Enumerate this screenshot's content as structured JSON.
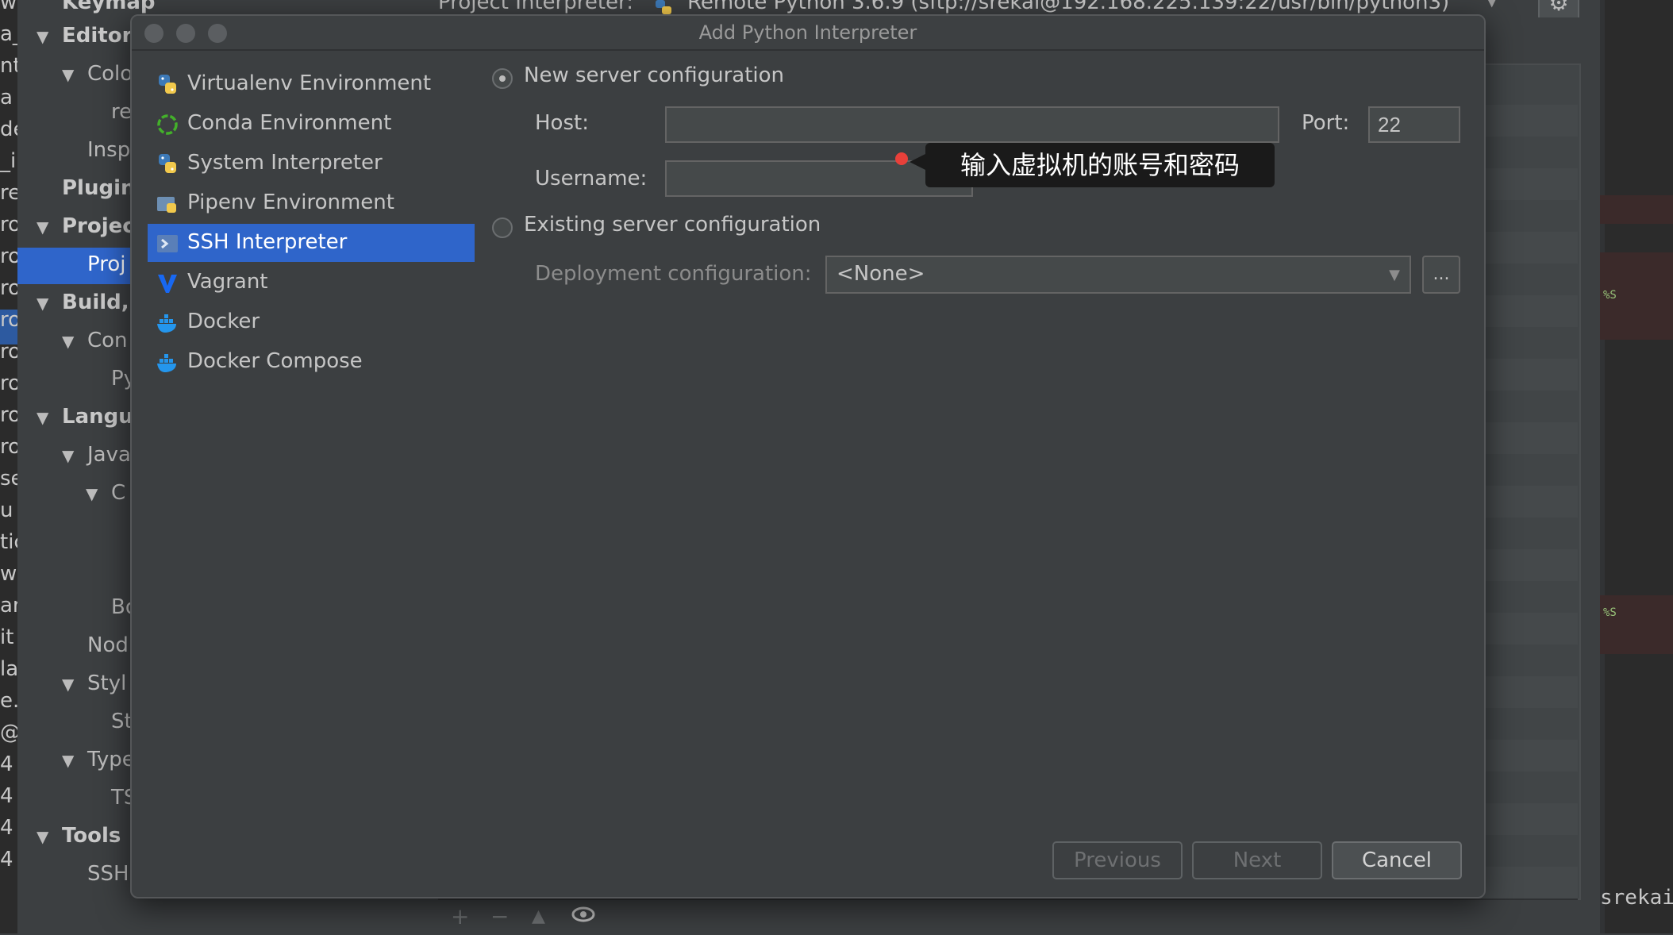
{
  "background": {
    "left_strip_chars": [
      "w",
      "a_",
      "nti",
      "a",
      "de",
      "_i",
      "re",
      "ro",
      "ro",
      "ro",
      "ro",
      "ro",
      "ro",
      "ro",
      "ro",
      "se",
      "u",
      "tic",
      "ws",
      "ar",
      "it",
      "la",
      "e.",
      "@",
      "4",
      "4",
      "4",
      "4"
    ],
    "settings_tree": {
      "nodes": [
        {
          "label": "Keymap",
          "bold": true
        },
        {
          "label": "Editor",
          "bold": true
        },
        {
          "label": "Colo"
        },
        {
          "label": "re"
        },
        {
          "label": "Insp"
        },
        {
          "label": "Plugin",
          "bold": true
        },
        {
          "label": "Projec",
          "bold": true
        },
        {
          "label": "Proj",
          "selected": true
        },
        {
          "label": "Build,",
          "bold": true
        },
        {
          "label": "Con"
        },
        {
          "label": "Py"
        },
        {
          "label": "Langu",
          "bold": true
        },
        {
          "label": "Java"
        },
        {
          "label": "C"
        },
        {
          "label": "Bo"
        },
        {
          "label": "Nod"
        },
        {
          "label": "Styl"
        },
        {
          "label": "St"
        },
        {
          "label": "Type"
        },
        {
          "label": "TS"
        },
        {
          "label": "Tools",
          "bold": true
        },
        {
          "label": "SSH"
        }
      ]
    },
    "project_interpreter": {
      "label": "Project Interpreter:",
      "value": "Remote Python 3.6.9 (sftp://srekai@192.168.225.139:22/usr/bin/python3)"
    },
    "editor": {
      "marker_text": "%S",
      "tail_text": "srekai/D"
    }
  },
  "dialog": {
    "title": "Add Python Interpreter",
    "interpreter_types": [
      {
        "label": "Virtualenv Environment",
        "icon": "python-icon"
      },
      {
        "label": "Conda Environment",
        "icon": "conda-icon"
      },
      {
        "label": "System Interpreter",
        "icon": "python-icon"
      },
      {
        "label": "Pipenv Environment",
        "icon": "pipenv-icon"
      },
      {
        "label": "SSH Interpreter",
        "icon": "ssh-icon",
        "selected": true
      },
      {
        "label": "Vagrant",
        "icon": "vagrant-icon"
      },
      {
        "label": "Docker",
        "icon": "docker-icon"
      },
      {
        "label": "Docker Compose",
        "icon": "docker-icon"
      }
    ],
    "new_server": {
      "label": "New server configuration",
      "selected": true,
      "host_label": "Host:",
      "host_value": "",
      "port_label": "Port:",
      "port_value": "22",
      "username_label": "Username:",
      "username_value": ""
    },
    "tooltip": "输入虚拟机的账号和密码",
    "existing_server": {
      "label": "Existing server configuration",
      "selected": false,
      "deployment_label": "Deployment configuration:",
      "deployment_value": "<None>",
      "more_label": "..."
    },
    "buttons": {
      "previous": "Previous",
      "next": "Next",
      "cancel": "Cancel"
    }
  },
  "colors": {
    "selection": "#2f65ca",
    "dialog_bg": "#3c3f41",
    "tooltip_bg": "#1a1a1a",
    "error_dot": "#e8403a"
  }
}
